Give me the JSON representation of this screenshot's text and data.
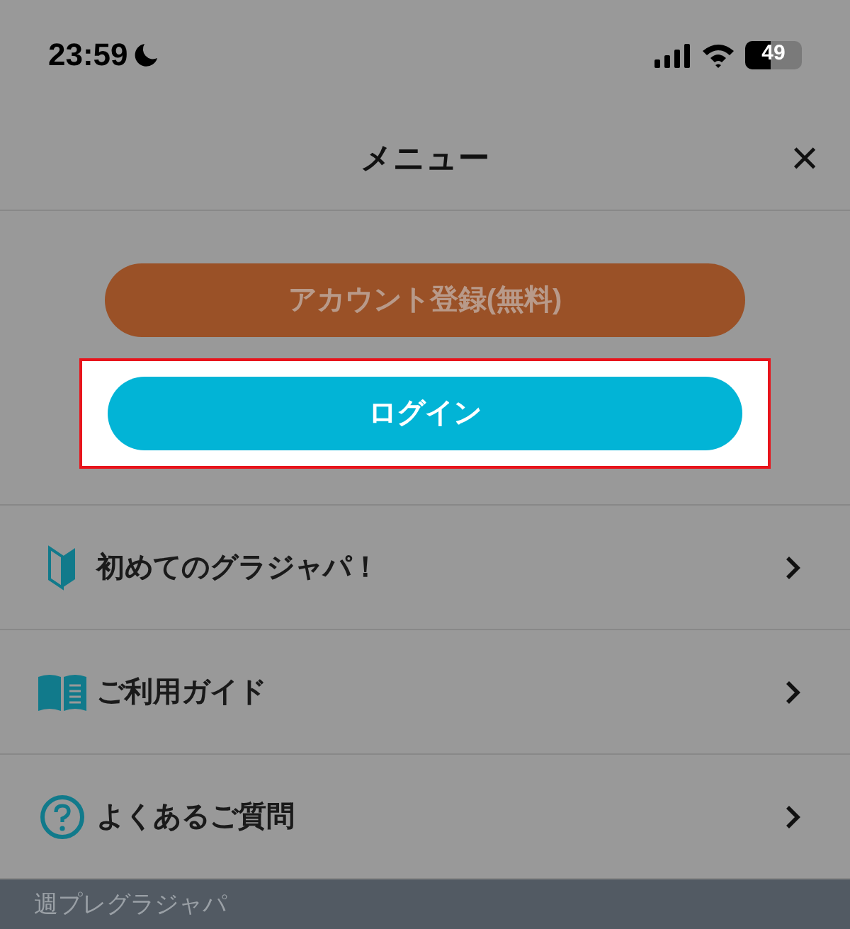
{
  "status_bar": {
    "time": "23:59",
    "battery": "49"
  },
  "header": {
    "title": "メニュー",
    "close": "×"
  },
  "buttons": [
    {
      "label": "アカウント登録(無料)",
      "color": "#9a5127",
      "highlighted": false
    },
    {
      "label": "ログイン",
      "color": "#02b4d6",
      "highlighted": true
    }
  ],
  "items": [
    {
      "kind": "beginner",
      "label": "初めてのグラジャパ！"
    },
    {
      "kind": "guide",
      "label": "ご利用ガイド"
    },
    {
      "kind": "faq",
      "label": "よくあるご質問"
    }
  ],
  "footer": {
    "label": "週プレグラジャパ"
  }
}
